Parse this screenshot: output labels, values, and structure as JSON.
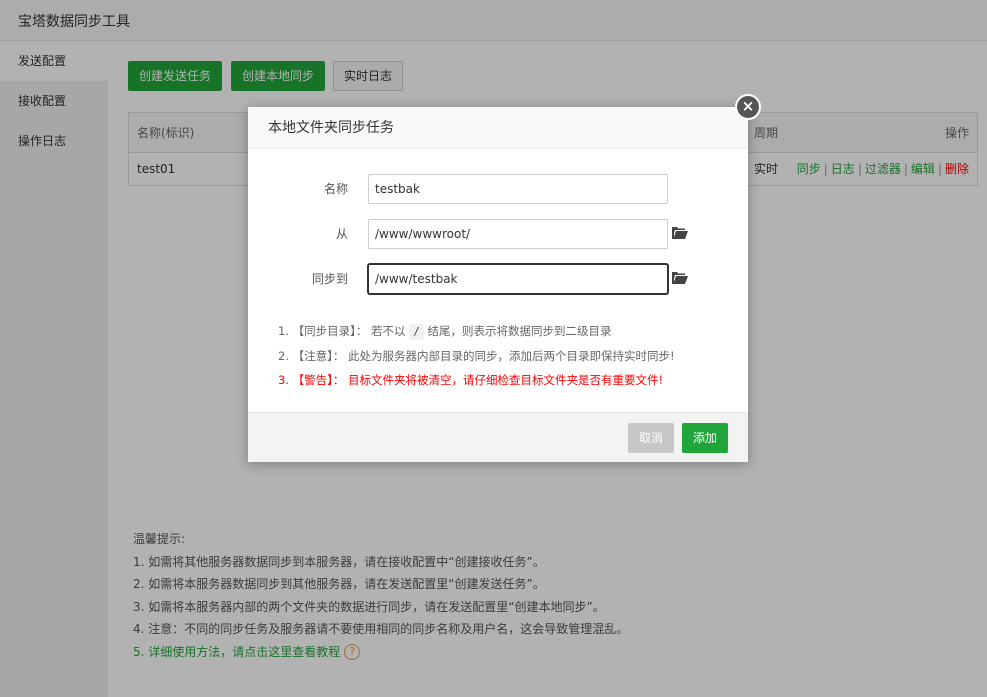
{
  "app": {
    "title": "宝塔数据同步工具"
  },
  "sidebar": {
    "items": [
      {
        "label": "发送配置"
      },
      {
        "label": "接收配置"
      },
      {
        "label": "操作日志"
      }
    ]
  },
  "toolbar": {
    "create_send": "创建发送任务",
    "create_local": "创建本地同步",
    "realtime_log": "实时日志"
  },
  "table": {
    "headers": {
      "name": "名称(标识)",
      "cycle": "周期",
      "actions": "操作"
    },
    "rows": [
      {
        "name": "test01",
        "cycle": "实时",
        "actions": [
          "同步",
          "日志",
          "过滤器",
          "编辑",
          "删除"
        ]
      }
    ]
  },
  "tips": {
    "title": "温馨提示:",
    "items": [
      "1. 如需将其他服务器数据同步到本服务器，请在接收配置中“创建接收任务”。",
      "2. 如需将本服务器数据同步到其他服务器，请在发送配置里“创建发送任务”。",
      "3. 如需将本服务器内部的两个文件夹的数据进行同步，请在发送配置里“创建本地同步”。",
      "4. 注意：不同的同步任务及服务器请不要使用相同的同步名称及用户名，这会导致管理混乱。"
    ],
    "link": "5. 详细使用方法，请点击这里查看教程",
    "help_glyph": "?"
  },
  "dialog": {
    "title": "本地文件夹同步任务",
    "close_glyph": "×",
    "fields": {
      "name": {
        "label": "名称",
        "value": "testbak"
      },
      "from": {
        "label": "从",
        "value": "/www/wwwroot/"
      },
      "target": {
        "label": "同步到",
        "value": "/www/testbak"
      }
    },
    "notes": {
      "n1_prefix": "1. 【同步目录】：  若不以",
      "n1_code": "/",
      "n1_suffix": "结尾，则表示将数据同步到二级目录",
      "n2": "2. 【注意】：  此处为服务器内部目录的同步，添加后两个目录即保持实时同步!",
      "n3": "3. 【警告】：  目标文件夹将被清空，请仔细检查目标文件夹是否有重要文件!"
    },
    "cancel": "取消",
    "add": "添加"
  },
  "colors": {
    "accent": "#20a53a",
    "danger": "#ff0000",
    "folder": "#444444"
  }
}
